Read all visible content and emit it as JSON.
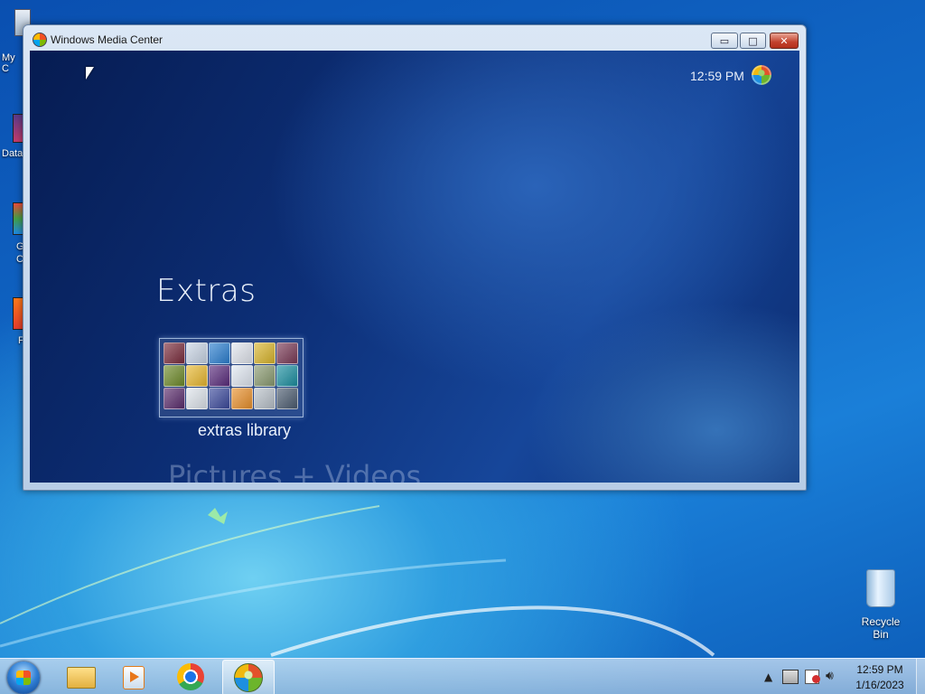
{
  "desktop": {
    "icons": [
      {
        "label": "My C"
      },
      {
        "label": "Data"
      },
      {
        "label": "G\nC"
      },
      {
        "label": "F"
      }
    ],
    "recycle_bin": {
      "label": "Recycle Bin"
    }
  },
  "window": {
    "title": "Windows Media Center",
    "controls": {
      "minimize": "▭",
      "maximize": "□",
      "close": "✕"
    }
  },
  "media_center": {
    "clock": "12:59 PM",
    "section_title": "Extras",
    "tile_label": "extras library",
    "next_section": "Pictures + Videos",
    "tile_colors": [
      "#7a2c3c",
      "#c8d4e4",
      "#2c7fd0",
      "#e0e4ec",
      "#d9b52c",
      "#7a3a56",
      "#6e8a2a",
      "#e8b830",
      "#5a2c7c",
      "#dfe6f0",
      "#8a9a70",
      "#1c8fa0",
      "#5a2c6c",
      "#dde3ea",
      "#3c4a9c",
      "#e8902c",
      "#b8c0c8",
      "#4c5c70"
    ]
  },
  "taskbar": {
    "apps": [
      {
        "name": "file-explorer"
      },
      {
        "name": "media-player"
      },
      {
        "name": "chrome"
      },
      {
        "name": "media-center"
      }
    ],
    "tray": {
      "time": "12:59 PM",
      "date": "1/16/2023"
    }
  },
  "colors": {
    "accent": "#1169c7",
    "window_border": "#6b86a8"
  }
}
